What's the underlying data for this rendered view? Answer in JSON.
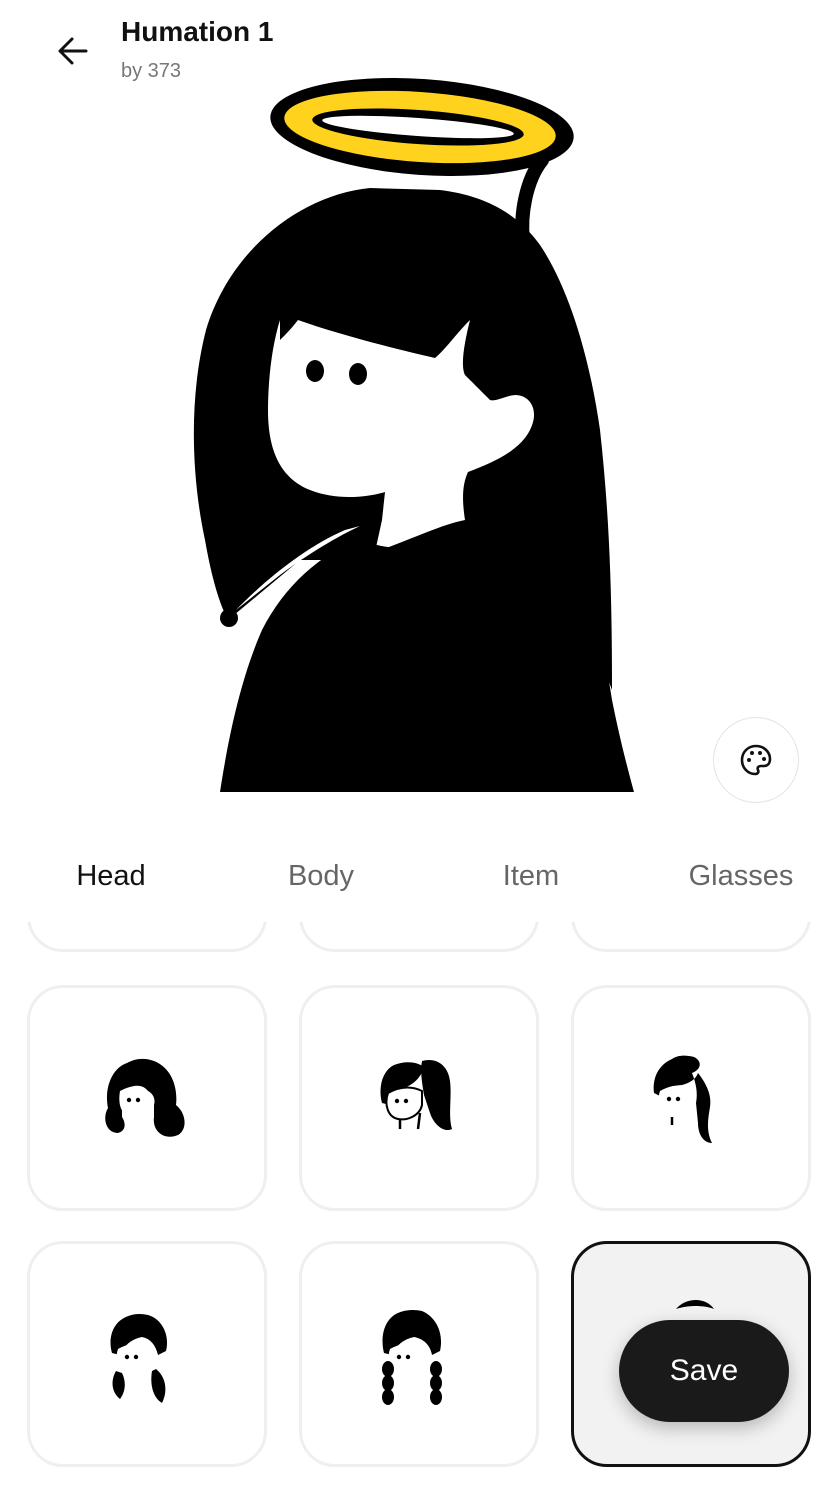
{
  "header": {
    "title": "Humation 1",
    "subtitle": "by 373",
    "back_icon": "arrow-left-icon"
  },
  "palette_button": {
    "icon": "palette-icon"
  },
  "tabs": [
    {
      "label": "Head",
      "active": true
    },
    {
      "label": "Body",
      "active": false
    },
    {
      "label": "Item",
      "active": false
    },
    {
      "label": "Glasses",
      "active": false
    }
  ],
  "head_options": [
    {
      "name": "short-curly-hair",
      "selected": false
    },
    {
      "name": "ponytail-hair",
      "selected": false
    },
    {
      "name": "long-wavy-hair",
      "selected": false
    },
    {
      "name": "pigtails-hair",
      "selected": false
    },
    {
      "name": "braids-hair",
      "selected": false
    },
    {
      "name": "long-straight-hair",
      "selected": true
    }
  ],
  "save_label": "Save",
  "colors": {
    "halo": "#FFD21E",
    "ink": "#000000",
    "save_bg": "#1A1A1A",
    "tile_border": "#EFEFEF",
    "selected_tile_bg": "#F3F2F2"
  }
}
